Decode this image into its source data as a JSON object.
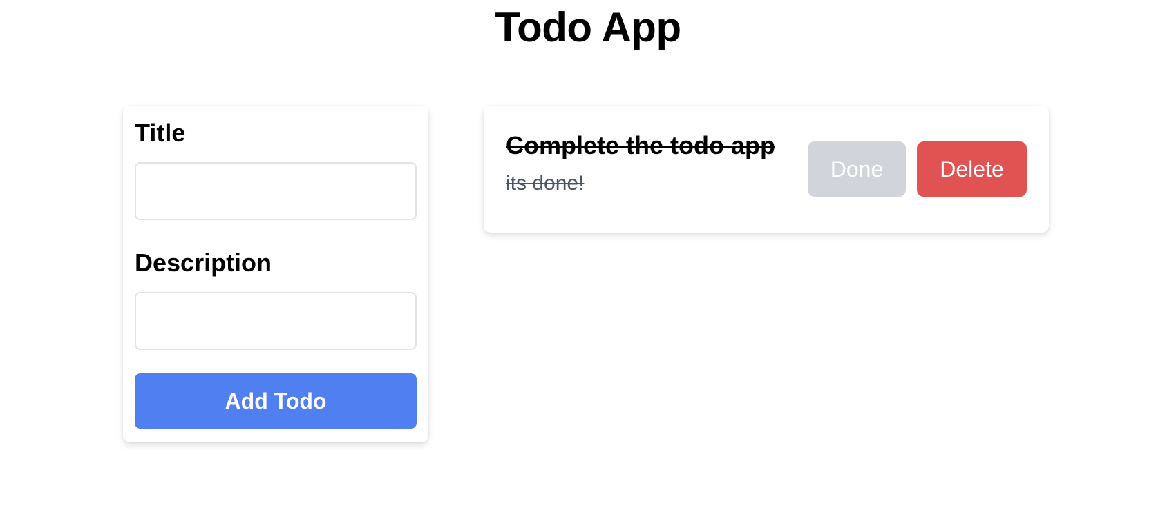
{
  "app": {
    "title": "Todo App"
  },
  "form": {
    "title_label": "Title",
    "title_value": "",
    "description_label": "Description",
    "description_value": "",
    "submit_label": "Add Todo"
  },
  "todos": [
    {
      "title": "Complete the todo app",
      "description": "its done!",
      "completed": true,
      "done_label": "Done",
      "delete_label": "Delete"
    }
  ],
  "colors": {
    "primary": "#4f7ff0",
    "danger": "#e05352",
    "disabled": "#d1d5db",
    "muted_text": "#4b5563"
  }
}
